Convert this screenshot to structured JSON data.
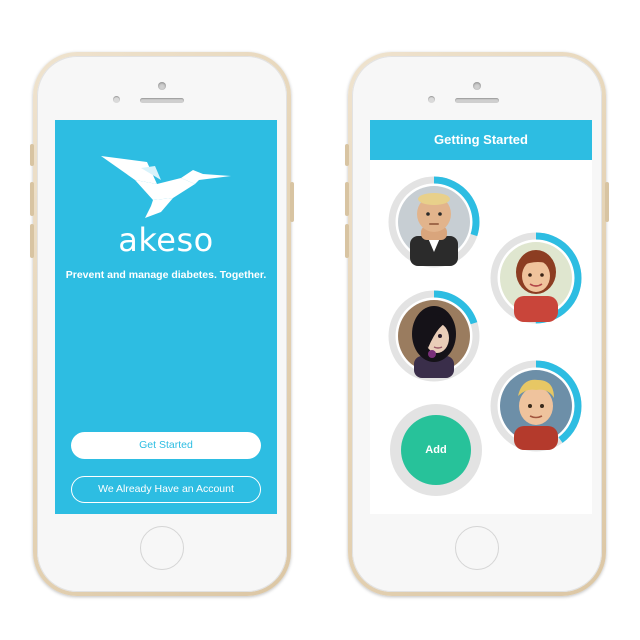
{
  "colors": {
    "brand_blue": "#2dbde2",
    "add_green": "#27c29a",
    "ring_track": "#e3e3e3",
    "phone_gold": "#e6d5b8"
  },
  "welcome_screen": {
    "logo_icon": "hummingbird-icon",
    "brand_name": "akeso",
    "tagline": "Prevent and manage diabetes. Together.",
    "primary_button": "Get Started",
    "secondary_button": "We Already Have an Account"
  },
  "getting_started_screen": {
    "title": "Getting Started",
    "family_members": [
      {
        "avatar": "dad-avatar",
        "progress": 0.3
      },
      {
        "avatar": "mom-avatar",
        "progress": 0.5
      },
      {
        "avatar": "daughter-avatar",
        "progress": 0.2
      },
      {
        "avatar": "son-avatar",
        "progress": 0.4
      }
    ],
    "add_button": "Add"
  }
}
